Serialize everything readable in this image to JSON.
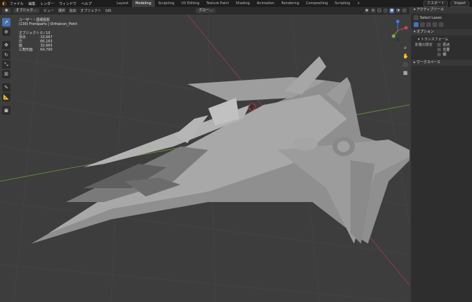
{
  "topbar": {
    "menu": [
      "ファイル",
      "編集",
      "レンダー",
      "ウィンドウ",
      "ヘルプ"
    ],
    "tabs": [
      "Layout",
      "Modeling",
      "Sculpting",
      "UV Editing",
      "Texture Paint",
      "Shading",
      "Animation",
      "Rendering",
      "Compositing",
      "Scripting",
      "+"
    ],
    "active_tab": "Modeling",
    "scene_label": "ミスポート",
    "import_label": "Import"
  },
  "header": {
    "mode": "オブジェク…",
    "menu": [
      "ビュー",
      "選択",
      "追加",
      "オブジェクト",
      "GIS"
    ],
    "orientation": "グロー…"
  },
  "overlay": {
    "view_name": "ユーザー・透視投影",
    "collection": "(130) Frontparts | Orihalcon_Point",
    "stats": [
      {
        "label": "オブジェクト",
        "value": "0 / 10"
      },
      {
        "label": "頂点",
        "value": "33,687"
      },
      {
        "label": "辺",
        "value": "66,163"
      },
      {
        "label": "面",
        "value": "32,665"
      },
      {
        "label": "三角形面",
        "value": "64,790"
      }
    ]
  },
  "panel": {
    "active_tool_header": "アクティブツール",
    "select_lasso": "Select Lasso",
    "options_header": "オプション",
    "transform_header": "トランスフォーム",
    "affect_only": "影響の限定",
    "checks": [
      "原点",
      "位置",
      "親"
    ],
    "workspace_header": "ワークスペース"
  },
  "colors": {
    "accent": "#4772b3",
    "background": "#3d3d3d",
    "axis_x": "#c9445a",
    "axis_y": "#7fb23f"
  }
}
